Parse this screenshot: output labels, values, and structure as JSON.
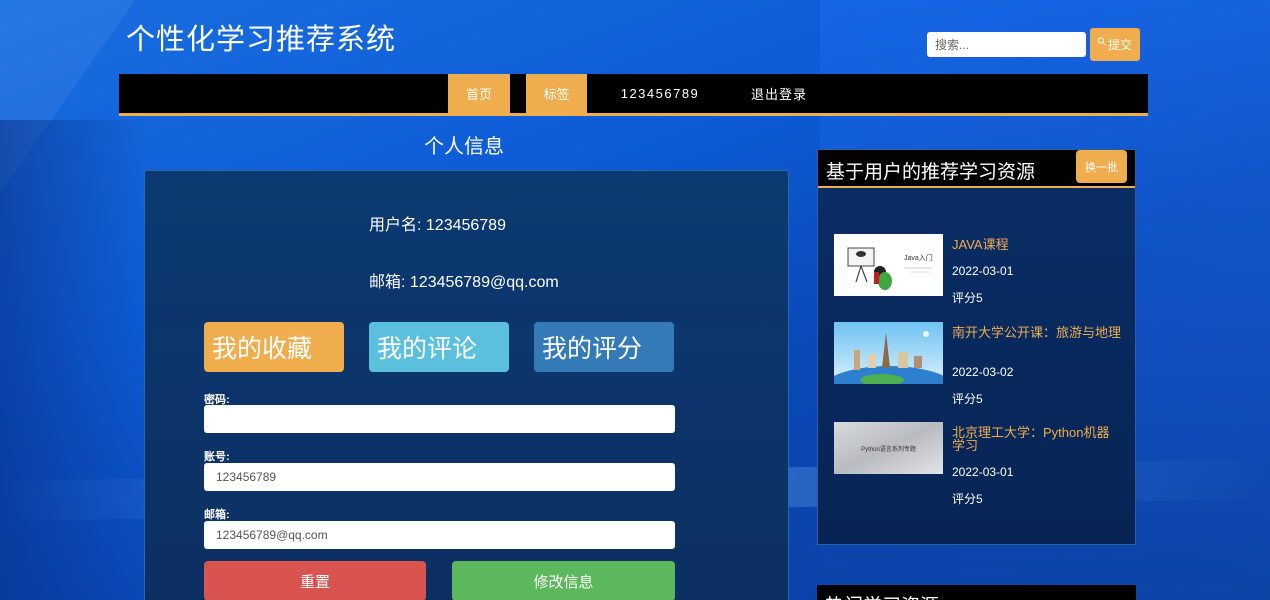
{
  "site": {
    "title": "个性化学习推荐系统"
  },
  "search": {
    "placeholder": "搜索...",
    "submit_label": "提交"
  },
  "nav": [
    {
      "label": "首页"
    },
    {
      "label": "标签"
    },
    {
      "label": "123456789"
    },
    {
      "label": "退出登录"
    }
  ],
  "profile": {
    "section_title": "个人信息",
    "username_line": "用户名: 123456789",
    "email_line": "邮箱: 123456789@qq.com",
    "tiles": [
      "我的收藏",
      "我的评论",
      "我的评分"
    ],
    "form": {
      "password_label": "密码:",
      "password_value": "",
      "account_label": "账号:",
      "account_value": "123456789",
      "email_label": "邮箱:",
      "email_value": "123456789@qq.com",
      "reset_label": "重置",
      "update_label": "修改信息"
    }
  },
  "recommend": {
    "title": "基于用户的推荐学习资源",
    "refresh_label": "换一批",
    "items": [
      {
        "name": "JAVA课程",
        "date": "2022-03-01",
        "score": "评分5",
        "thumb_text": "Java入门"
      },
      {
        "name": "南开大学公开课：旅游与地理",
        "date": "2022-03-02",
        "score": "评分5"
      },
      {
        "name": "北京理工大学：Python机器学习",
        "date": "2022-03-01",
        "score": "评分5",
        "thumb_text": "Python语言系列专题"
      }
    ]
  },
  "hot": {
    "title": "热门学习资源"
  },
  "colors": {
    "accent": "#f0ad4e",
    "info": "#5bc0de",
    "primary": "#337ab7",
    "danger": "#d9534f",
    "success": "#5cb85c"
  }
}
